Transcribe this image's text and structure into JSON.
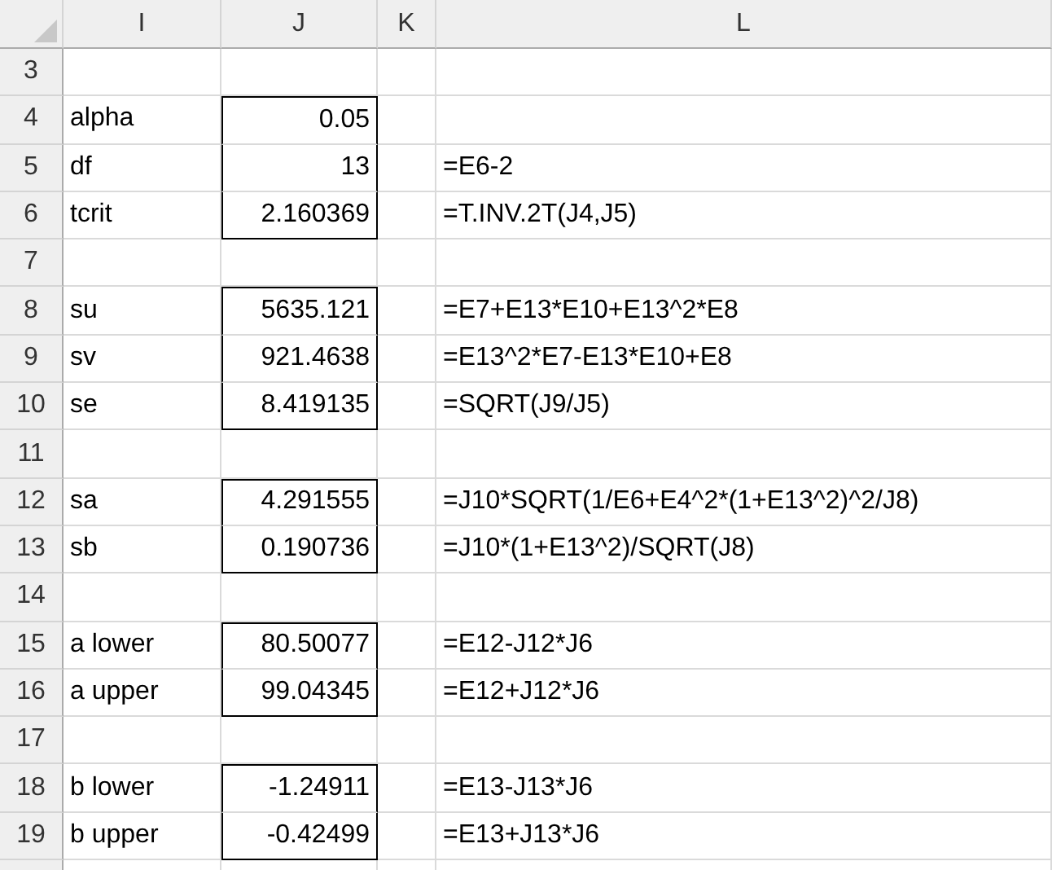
{
  "columns": [
    "I",
    "J",
    "K",
    "L"
  ],
  "rows": [
    {
      "row": "3",
      "label": "",
      "value": "",
      "formula": "",
      "boxed": false
    },
    {
      "row": "4",
      "label": "alpha",
      "value": "0.05",
      "formula": "",
      "boxed": true
    },
    {
      "row": "5",
      "label": "df",
      "value": "13",
      "formula": "=E6-2",
      "boxed": true
    },
    {
      "row": "6",
      "label": "tcrit",
      "value": "2.160369",
      "formula": "=T.INV.2T(J4,J5)",
      "boxed": true
    },
    {
      "row": "7",
      "label": "",
      "value": "",
      "formula": "",
      "boxed": false
    },
    {
      "row": "8",
      "label": "su",
      "value": "5635.121",
      "formula": "=E7+E13*E10+E13^2*E8",
      "boxed": true
    },
    {
      "row": "9",
      "label": "sv",
      "value": "921.4638",
      "formula": "=E13^2*E7-E13*E10+E8",
      "boxed": true
    },
    {
      "row": "10",
      "label": "se",
      "value": "8.419135",
      "formula": "=SQRT(J9/J5)",
      "boxed": true
    },
    {
      "row": "11",
      "label": "",
      "value": "",
      "formula": "",
      "boxed": false
    },
    {
      "row": "12",
      "label": "sa",
      "value": "4.291555",
      "formula": "=J10*SQRT(1/E6+E4^2*(1+E13^2)^2/J8)",
      "boxed": true
    },
    {
      "row": "13",
      "label": "sb",
      "value": "0.190736",
      "formula": "=J10*(1+E13^2)/SQRT(J8)",
      "boxed": true
    },
    {
      "row": "14",
      "label": "",
      "value": "",
      "formula": "",
      "boxed": false
    },
    {
      "row": "15",
      "label": "a lower",
      "value": "80.50077",
      "formula": "=E12-J12*J6",
      "boxed": true
    },
    {
      "row": "16",
      "label": "a upper",
      "value": "99.04345",
      "formula": "=E12+J12*J6",
      "boxed": true
    },
    {
      "row": "17",
      "label": "",
      "value": "",
      "formula": "",
      "boxed": false
    },
    {
      "row": "18",
      "label": "b lower",
      "value": "-1.24911",
      "formula": "=E13-J13*J6",
      "boxed": true
    },
    {
      "row": "19",
      "label": "b upper",
      "value": "-0.42499",
      "formula": "=E13+J13*J6",
      "boxed": true
    }
  ]
}
